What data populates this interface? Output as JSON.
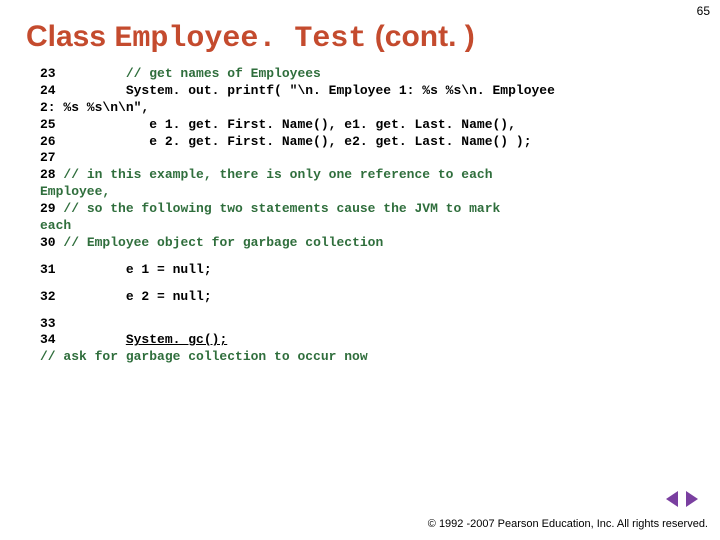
{
  "page_number": "65",
  "title": {
    "prefix": "Class ",
    "mono": "Employee. Test",
    "suffix": " (cont. )"
  },
  "code": {
    "b1": {
      "l23_num": "23",
      "l23_cmt": "// get names of Employees",
      "l24_num": "24",
      "l24_txt": "System. out. printf( \"\\n. Employee 1: %s %s\\n. Employee",
      "l24b_txt": "2: %s %s\\n\\n\",",
      "l25_num": "25",
      "l25_txt": "e 1. get. First. Name(), e1. get. Last. Name(),",
      "l26_num": "26",
      "l26_txt": "e 2. get. First. Name(), e2. get. Last. Name() );",
      "l27_num": "27",
      "l28_num": "28",
      "l28_cmt": "// in this example, there is only one reference to each",
      "l28b_cmt": "Employee,",
      "l29_num": "29",
      "l29_cmt": "// so the following two statements cause the JVM to mark",
      "l29b_cmt": "each",
      "l30_num": "30",
      "l30_cmt": "// Employee object for garbage collection"
    },
    "b2": {
      "l31_num": "31",
      "l31_txt": "e 1 = null;"
    },
    "b3": {
      "l32_num": "32",
      "l32_txt": "e 2 = null;"
    },
    "b4": {
      "l33_num": "33",
      "l34_num": "34",
      "l34_txt": "System. gc();",
      "l34_cmt": "// ask for garbage collection to occur now"
    }
  },
  "footer": "© 1992 -2007 Pearson Education, Inc. All rights reserved."
}
